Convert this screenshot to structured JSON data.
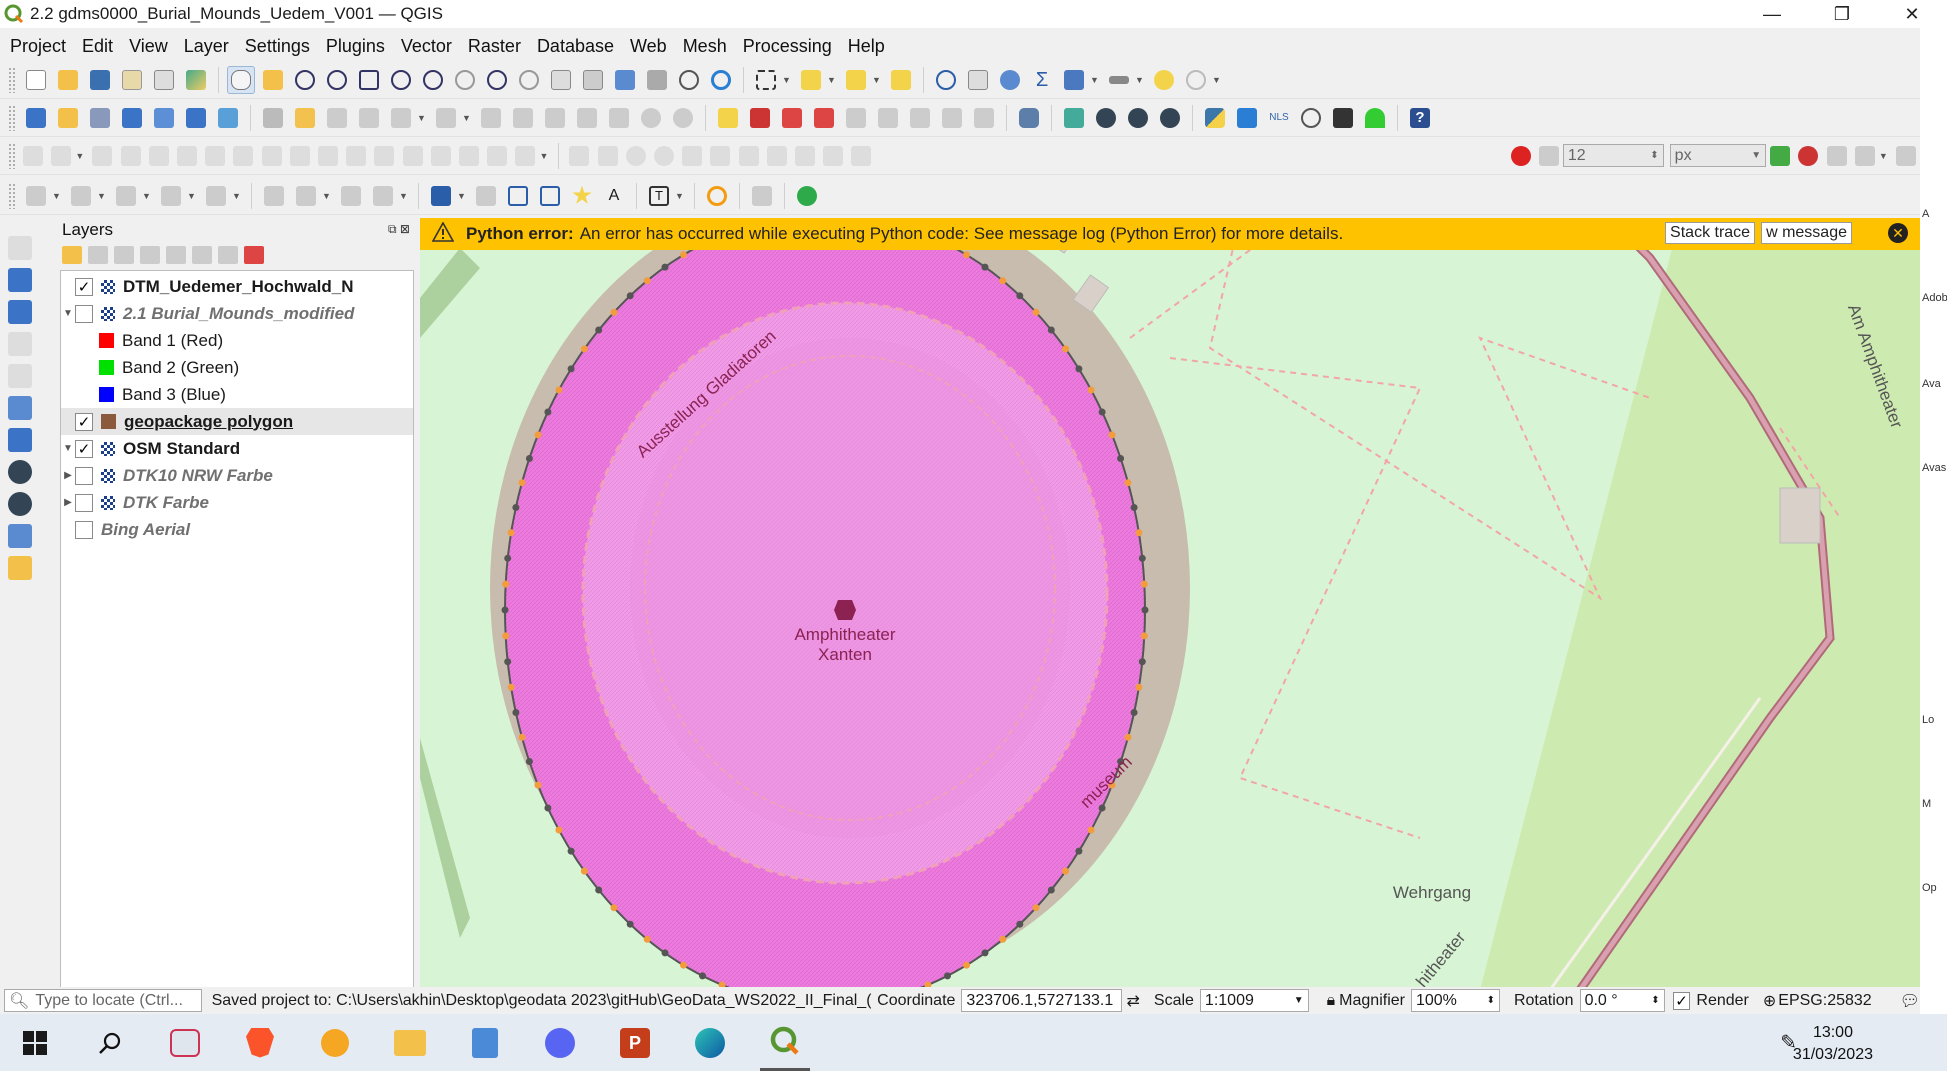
{
  "window": {
    "title": "2.2 gdms0000_Burial_Mounds_Uedem_V001 — QGIS",
    "minimize": "—",
    "restore": "❐",
    "close": "✕"
  },
  "menu": [
    "Project",
    "Edit",
    "View",
    "Layer",
    "Settings",
    "Plugins",
    "Vector",
    "Raster",
    "Database",
    "Web",
    "Mesh",
    "Processing",
    "Help"
  ],
  "digitize": {
    "size_value": "12",
    "unit_value": "px"
  },
  "layers_panel": {
    "title": "Layers",
    "items": [
      {
        "label": "DTM_Uedemer_Hochwald_N",
        "checked": true
      },
      {
        "label": "2.1 Burial_Mounds_modified",
        "checked": false
      },
      {
        "label": "Band 1 (Red)",
        "color": "#ff0000"
      },
      {
        "label": "Band 2 (Green)",
        "color": "#00e000"
      },
      {
        "label": "Band 3 (Blue)",
        "color": "#0000ff"
      },
      {
        "label": "geopackage polygon",
        "checked": true,
        "color": "#8b5a3c"
      },
      {
        "label": "OSM Standard",
        "checked": true
      },
      {
        "label": "DTK10 NRW Farbe",
        "checked": false
      },
      {
        "label": "DTK Farbe",
        "checked": false
      },
      {
        "label": "Bing Aerial",
        "checked": false
      }
    ]
  },
  "error": {
    "title": "Python error:",
    "message": "An error has occurred while executing Python code: See message log (Python Error) for more details.",
    "stack_trace": "Stack trace",
    "view_message": "w message"
  },
  "map": {
    "labels": {
      "amphitheater": "Amphitheater",
      "xanten": "Xanten",
      "ausstellung": "Ausstellung Gladiatoren",
      "museum": "museum",
      "wehrgang": "Wehrgang",
      "am_amphitheater": "Am Amphitheater",
      "theater_fragment": "hitheater"
    }
  },
  "status": {
    "locate_placeholder": "Type to locate (Ctrl...",
    "saved": "Saved project to: C:\\Users\\akhin\\Desktop\\geodata 2023\\gitHub\\GeoData_WS2022_II_Final_(",
    "coordinate_label": "Coordinate",
    "coordinate_value": "323706.1,5727133.1",
    "scale_label": "Scale",
    "scale_value": "1:1009",
    "magnifier_label": "Magnifier",
    "magnifier_value": "100%",
    "rotation_label": "Rotation",
    "rotation_value": "0.0 °",
    "render_label": "Render",
    "crs": "EPSG:25832"
  },
  "right_strip": [
    "A",
    "Adob",
    "Ava",
    "Avas",
    "Lo",
    "M",
    "Op"
  ],
  "taskbar": {
    "time": "13:00",
    "date": "31/03/2023"
  },
  "colors": {
    "error_bar": "#ffc200",
    "polygon_fill": "#ee7be0",
    "map_bg": "#d7f5d4",
    "path_dash": "#f0a0b8"
  }
}
